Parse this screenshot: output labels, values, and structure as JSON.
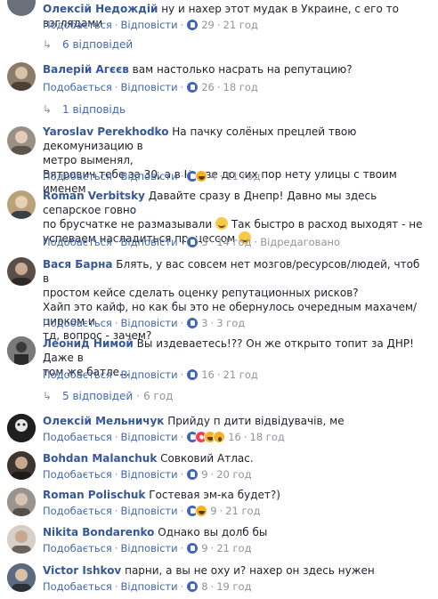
{
  "actions": {
    "like": "Подобається",
    "reply": "Відповісти",
    "edited": "Відредаговано"
  },
  "comments": [
    {
      "name": "Олексій Недождій",
      "text": "ну и нахер этот мудак в Украине, с его то взглядами",
      "likes": "29",
      "time": "21 год",
      "avatar_color": "#6b6f7a"
    },
    {
      "name": "Валерій Агєєв",
      "text": "вам настолько насрать на репутацию?",
      "likes": "26",
      "time": "18 год",
      "avatar_color": "#8a7b6a"
    },
    {
      "name": "Yaroslav Perekhodko",
      "text1": "На пачку солёных прецлей твою декомунизацию в",
      "text2": "метро выменял,",
      "text3": "Вятрович тебе за 30, а в Киеве до сих пор нету улицы с твоим именем",
      "likes": "4",
      "time": "11 год",
      "avatar_color": "#9a8f85"
    },
    {
      "name": "Roman Verbitsky",
      "text1": "Давайте сразу в Днепр! Давно мы здесь сепарское говно",
      "text2": "по брусчатке не размазывали",
      "text2b": "Так быстро в расход выходят - не",
      "text3": "успеваем насладиться процессом",
      "likes": "3",
      "time": "14 год",
      "avatar_color": "#b9a17c"
    },
    {
      "name": "Вася Барна",
      "text1": "Блять, у вас совсем нет мозгов/ресурсов/людей, чтоб в",
      "text2": "простом кейсе сделать оценку репутационных рисков?",
      "text3": "Хайп это кайф, но как бы это не обернулось очередным махачем/цирком и",
      "text4": "тд, вопрос - зачем?",
      "likes": "3",
      "time": "3 год",
      "avatar_color": "#5a4e48"
    },
    {
      "name": "Леонид Нимой",
      "text1": "Вы издеваетесь!?? Он же открыто топит за ДНР! Даже в",
      "text2": "том же батле...",
      "likes": "16",
      "time": "21 год",
      "avatar_color": "#4a4a4a"
    },
    {
      "name": "Олексій Мельничук",
      "text": "Прийду п   дити відвідувачів, ме",
      "likes": "16",
      "time": "18 год",
      "avatar_color": "#2b2b2b"
    },
    {
      "name": "Bohdan Malanchuk",
      "text": "Совковий Атлас.",
      "likes": "9",
      "time": "20 год",
      "avatar_color": "#3c3530"
    },
    {
      "name": "Roman Polischuk",
      "text": "Гостевая эм-ка будет?)",
      "likes": "9",
      "time": "21 год",
      "avatar_color": "#6e6a66"
    },
    {
      "name": "Nikita Bondarenko",
      "text": "Однако вы долб    бы",
      "likes": "9",
      "time": "21 год",
      "avatar_color": "#a89c94"
    },
    {
      "name": "Victor Ishkov",
      "text": "парни, а вы не оху   и? нахер он здесь нужен",
      "likes": "8",
      "time": "19 год",
      "avatar_color": "#3d4a5c"
    }
  ],
  "replies": [
    {
      "label": "6 відповідей",
      "time": ""
    },
    {
      "label": "1 відповідь",
      "time": ""
    },
    {
      "label": "5 відповідей",
      "time": "6 год"
    }
  ]
}
